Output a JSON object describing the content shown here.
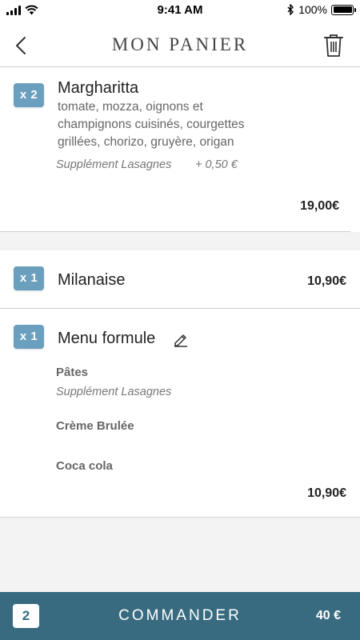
{
  "status_bar": {
    "time": "9:41 AM",
    "battery": "100%",
    "battery_level": 1.0
  },
  "header": {
    "title": "MON PANIER",
    "back_icon": "chevron-left-icon",
    "trash_icon": "trash-icon"
  },
  "items": [
    {
      "qty": "x 2",
      "name": "Margharitta",
      "description": "tomate, mozza, oignons et champignons cuisinés,  courgettes grillées, chorizo, gruyère, origan",
      "supplement": "Supplément Lasagnes",
      "supplement_price": "+ 0,50 €",
      "price": "19,00€"
    },
    {
      "qty": "x 1",
      "name": "Milanaise",
      "price": "10,90€"
    },
    {
      "qty": "x 1",
      "name": "Menu formule",
      "edit_icon": "pencil-icon",
      "components": [
        {
          "label": "Pâtes",
          "supplement": "Supplément Lasagnes"
        },
        {
          "label": "Crème Brulée"
        },
        {
          "label": "Coca cola"
        }
      ],
      "price": "10,90€"
    }
  ],
  "footer": {
    "count": "2",
    "action": "COMMANDER",
    "total": "40 €"
  },
  "colors": {
    "accent": "#6a9fbd",
    "footer": "#386b80"
  }
}
